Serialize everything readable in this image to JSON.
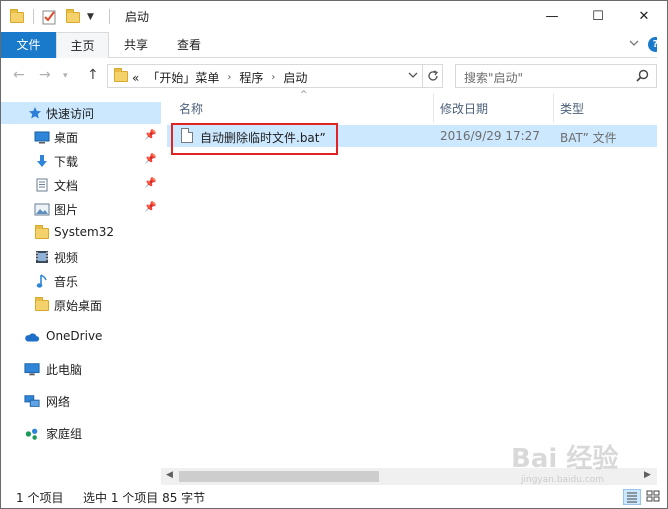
{
  "window": {
    "title": "启动",
    "minimize": "—",
    "maximize": "☐",
    "close": "✕"
  },
  "ribbon": {
    "tabs": [
      {
        "label": "文件"
      },
      {
        "label": "主页"
      },
      {
        "label": "共享"
      },
      {
        "label": "查看"
      }
    ],
    "expand_icon": "chevron-down-icon",
    "help_label": "?"
  },
  "address": {
    "overflow": "«",
    "crumbs": [
      "「开始」菜单",
      "程序",
      "启动"
    ],
    "search_placeholder": "搜索\"启动\""
  },
  "nav": {
    "quick_access": "快速访问",
    "items": [
      {
        "label": "桌面",
        "icon": "desktop-icon",
        "pinned": true
      },
      {
        "label": "下载",
        "icon": "download-icon",
        "pinned": true
      },
      {
        "label": "文档",
        "icon": "document-icon",
        "pinned": true
      },
      {
        "label": "图片",
        "icon": "picture-icon",
        "pinned": true
      },
      {
        "label": "System32",
        "icon": "folder-icon",
        "pinned": false
      },
      {
        "label": "视频",
        "icon": "video-icon",
        "pinned": false
      },
      {
        "label": "音乐",
        "icon": "music-icon",
        "pinned": false
      },
      {
        "label": "原始桌面",
        "icon": "folder-icon",
        "pinned": false
      }
    ],
    "onedrive": "OneDrive",
    "this_pc": "此电脑",
    "network": "网络",
    "homegroup": "家庭组"
  },
  "columns": {
    "name": "名称",
    "modified": "修改日期",
    "type": "类型"
  },
  "files": [
    {
      "name": "自动删除临时文件.bat”",
      "modified": "2016/9/29 17:27",
      "type": "BAT” 文件"
    }
  ],
  "status": {
    "count": "1 个项目",
    "selected": "选中 1 个项目  85 字节"
  },
  "watermark": {
    "main": "Bai 经验",
    "sub": "jingyan.baidu.com"
  },
  "colors": {
    "accent": "#1979ca",
    "selection": "#cce8ff",
    "highlight_box": "#e02424"
  }
}
